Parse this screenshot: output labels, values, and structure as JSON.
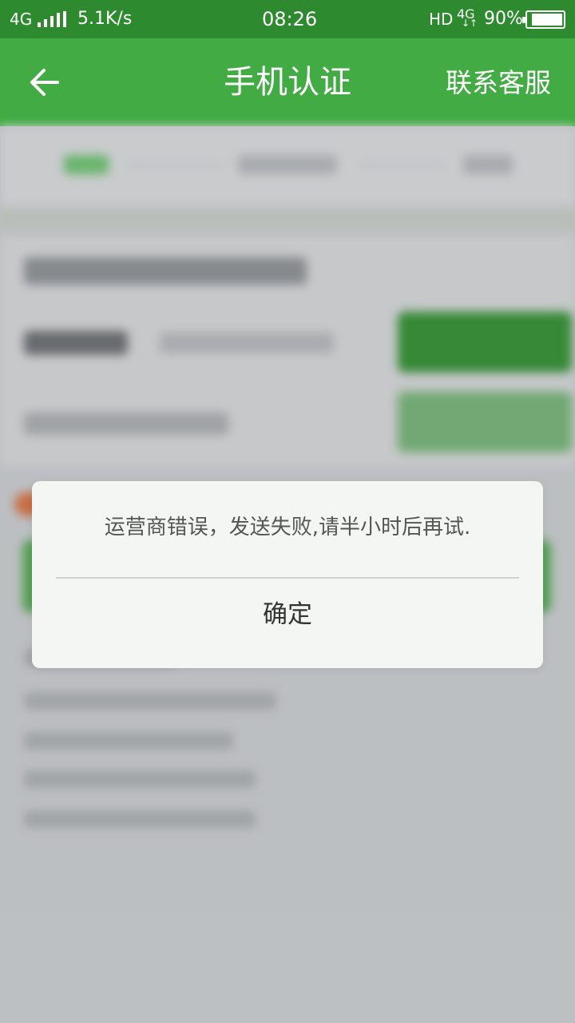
{
  "status_bar": {
    "network": "4G",
    "speed": "5.1K/s",
    "time": "08:26",
    "hd": "HD",
    "network2": "4G",
    "battery": "90%",
    "battery_level": 0.9
  },
  "app_bar": {
    "title": "手机认证",
    "contact_label": "联系客服",
    "back_icon": "arrow-left-icon"
  },
  "dialog": {
    "message": "运营商错误，发送失败,请半小时后再试.",
    "ok_label": "确定"
  },
  "colors": {
    "status_bar": "#2e8a2e",
    "app_bar": "#42ab43",
    "background": "#c7cacd",
    "dialog": "#f4f6f4"
  }
}
